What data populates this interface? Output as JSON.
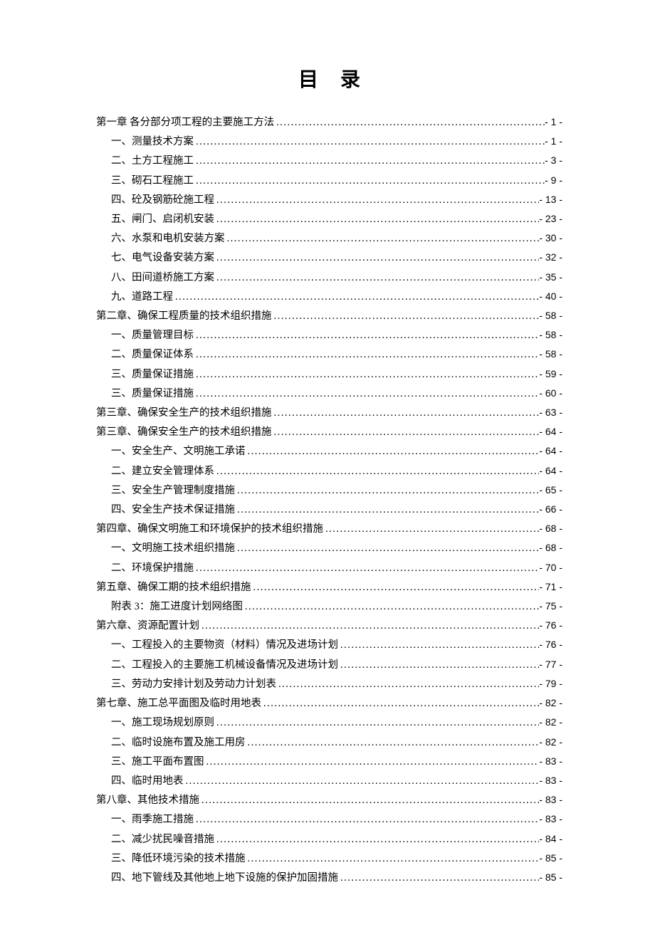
{
  "title": "目 录",
  "entries": [
    {
      "level": 1,
      "label": "第一章 各分部分项工程的主要施工方法",
      "page": "- 1 -"
    },
    {
      "level": 2,
      "label": "一、测量技术方案",
      "page": "- 1 -"
    },
    {
      "level": 2,
      "label": "二、土方工程施工",
      "page": "- 3 -"
    },
    {
      "level": 2,
      "label": "三、砌石工程施工",
      "page": "- 9 -"
    },
    {
      "level": 2,
      "label": "四、砼及钢筋砼施工程",
      "page": "- 13 -"
    },
    {
      "level": 2,
      "label": "五、闸门、启闭机安装",
      "page": "- 23 -"
    },
    {
      "level": 2,
      "label": "六、水泵和电机安装方案",
      "page": "- 30 -"
    },
    {
      "level": 2,
      "label": "七、电气设备安装方案",
      "page": "- 32 -"
    },
    {
      "level": 2,
      "label": "八、田间道桥施工方案",
      "page": "- 35 -"
    },
    {
      "level": 2,
      "label": "九、道路工程",
      "page": "- 40 -"
    },
    {
      "level": 1,
      "label": "第二章、确保工程质量的技术组织措施",
      "page": "- 58 -"
    },
    {
      "level": 2,
      "label": "一、质量管理目标",
      "page": "- 58 -"
    },
    {
      "level": 2,
      "label": "二、质量保证体系",
      "page": "- 58 -"
    },
    {
      "level": 2,
      "label": "三、质量保证措施",
      "page": "- 59 -"
    },
    {
      "level": 2,
      "label": "三、质量保证措施",
      "page": "- 60 -"
    },
    {
      "level": 1,
      "label": "第三章、确保安全生产的技术组织措施",
      "page": "- 63 -"
    },
    {
      "level": 1,
      "label": "第三章、确保安全生产的技术组织措施",
      "page": "- 64 -"
    },
    {
      "level": 2,
      "label": "一、安全生产、文明施工承诺",
      "page": "- 64 -"
    },
    {
      "level": 2,
      "label": "二、建立安全管理体系",
      "page": "- 64 -"
    },
    {
      "level": 2,
      "label": "三、安全生产管理制度措施",
      "page": "- 65 -"
    },
    {
      "level": 2,
      "label": "四、安全生产技术保证措施",
      "page": "- 66 -"
    },
    {
      "level": 1,
      "label": "第四章、确保文明施工和环境保护的技术组织措施",
      "page": "- 68 -"
    },
    {
      "level": 2,
      "label": "一、文明施工技术组织措施",
      "page": "- 68 -"
    },
    {
      "level": 2,
      "label": "二、环境保护措施",
      "page": "- 70 -"
    },
    {
      "level": 1,
      "label": "第五章、确保工期的技术组织措施",
      "page": "- 71 -"
    },
    {
      "level": 2,
      "label": "附表 3：施工进度计划网络图",
      "page": "- 75 -"
    },
    {
      "level": 1,
      "label": "第六章、资源配置计划",
      "page": "- 76 -"
    },
    {
      "level": 2,
      "label": "一、工程投入的主要物资（材料）情况及进场计划",
      "page": "- 76 -"
    },
    {
      "level": 2,
      "label": "二、工程投入的主要施工机械设备情况及进场计划",
      "page": "- 77 -"
    },
    {
      "level": 2,
      "label": "三、劳动力安排计划及劳动力计划表",
      "page": "- 79 -"
    },
    {
      "level": 1,
      "label": "第七章、施工总平面图及临时用地表",
      "page": "- 82 -"
    },
    {
      "level": 2,
      "label": "一、施工现场规划原则",
      "page": "- 82 -"
    },
    {
      "level": 2,
      "label": "二、临时设施布置及施工用房",
      "page": "- 82 -"
    },
    {
      "level": 2,
      "label": "三、施工平面布置图",
      "page": "- 83 -"
    },
    {
      "level": 2,
      "label": "四、临时用地表",
      "page": "- 83 -"
    },
    {
      "level": 1,
      "label": "第八章、其他技术措施",
      "page": "- 83 -"
    },
    {
      "level": 2,
      "label": "一、雨季施工措施",
      "page": "- 83 -"
    },
    {
      "level": 2,
      "label": "二、减少扰民噪音措施",
      "page": "- 84 -"
    },
    {
      "level": 2,
      "label": "三、降低环境污染的技术措施",
      "page": "- 85 -"
    },
    {
      "level": 2,
      "label": "四、地下管线及其他地上地下设施的保护加固措施",
      "page": "- 85 -"
    }
  ]
}
